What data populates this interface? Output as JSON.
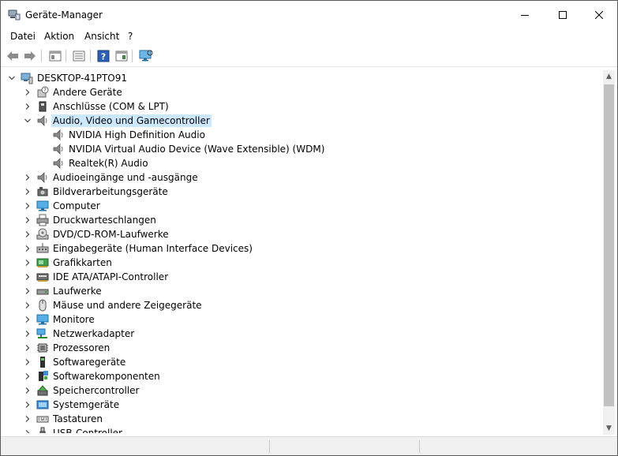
{
  "window": {
    "title": "Geräte-Manager"
  },
  "menu": [
    "Datei",
    "Aktion",
    "Ansicht",
    "?"
  ],
  "toolbar": {
    "icons": [
      "back-arrow-icon",
      "forward-arrow-icon",
      "properties-sheet-icon",
      "list-view-icon",
      "help-icon",
      "show-hidden-icon",
      "monitor-scan-icon"
    ]
  },
  "tree": {
    "root": "DESKTOP-41PTO91",
    "items": [
      {
        "label": "Andere Geräte",
        "icon": "unknown-device-icon",
        "expanded": false
      },
      {
        "label": "Anschlüsse (COM & LPT)",
        "icon": "port-icon",
        "expanded": false
      },
      {
        "label": "Audio, Video und Gamecontroller",
        "icon": "speaker-icon",
        "expanded": true,
        "selected": true,
        "children": [
          "NVIDIA High Definition Audio",
          "NVIDIA Virtual Audio Device (Wave Extensible) (WDM)",
          "Realtek(R) Audio"
        ]
      },
      {
        "label": "Audioeingänge und -ausgänge",
        "icon": "speaker-icon",
        "expanded": false
      },
      {
        "label": "Bildverarbeitungsgeräte",
        "icon": "camera-icon",
        "expanded": false
      },
      {
        "label": "Computer",
        "icon": "computer-icon",
        "expanded": false
      },
      {
        "label": "Druckwarteschlangen",
        "icon": "printer-icon",
        "expanded": false
      },
      {
        "label": "DVD/CD-ROM-Laufwerke",
        "icon": "disc-drive-icon",
        "expanded": false
      },
      {
        "label": "Eingabegeräte (Human Interface Devices)",
        "icon": "hid-icon",
        "expanded": false
      },
      {
        "label": "Grafikkarten",
        "icon": "display-adapter-icon",
        "expanded": false
      },
      {
        "label": "IDE ATA/ATAPI-Controller",
        "icon": "ide-controller-icon",
        "expanded": false
      },
      {
        "label": "Laufwerke",
        "icon": "disk-drive-icon",
        "expanded": false
      },
      {
        "label": "Mäuse und andere Zeigegeräte",
        "icon": "mouse-icon",
        "expanded": false
      },
      {
        "label": "Monitore",
        "icon": "monitor-icon",
        "expanded": false
      },
      {
        "label": "Netzwerkadapter",
        "icon": "network-adapter-icon",
        "expanded": false
      },
      {
        "label": "Prozessoren",
        "icon": "processor-icon",
        "expanded": false
      },
      {
        "label": "Softwaregeräte",
        "icon": "software-device-icon",
        "expanded": false
      },
      {
        "label": "Softwarekomponenten",
        "icon": "software-component-icon",
        "expanded": false
      },
      {
        "label": "Speichercontroller",
        "icon": "storage-controller-icon",
        "expanded": false
      },
      {
        "label": "Systemgeräte",
        "icon": "system-device-icon",
        "expanded": false
      },
      {
        "label": "Tastaturen",
        "icon": "keyboard-icon",
        "expanded": false
      },
      {
        "label": "USB-Controller",
        "icon": "usb-icon",
        "expanded": false
      }
    ]
  },
  "colors": {
    "selection": "#cce8ff",
    "scroll_thumb": "#c1c1c1"
  }
}
